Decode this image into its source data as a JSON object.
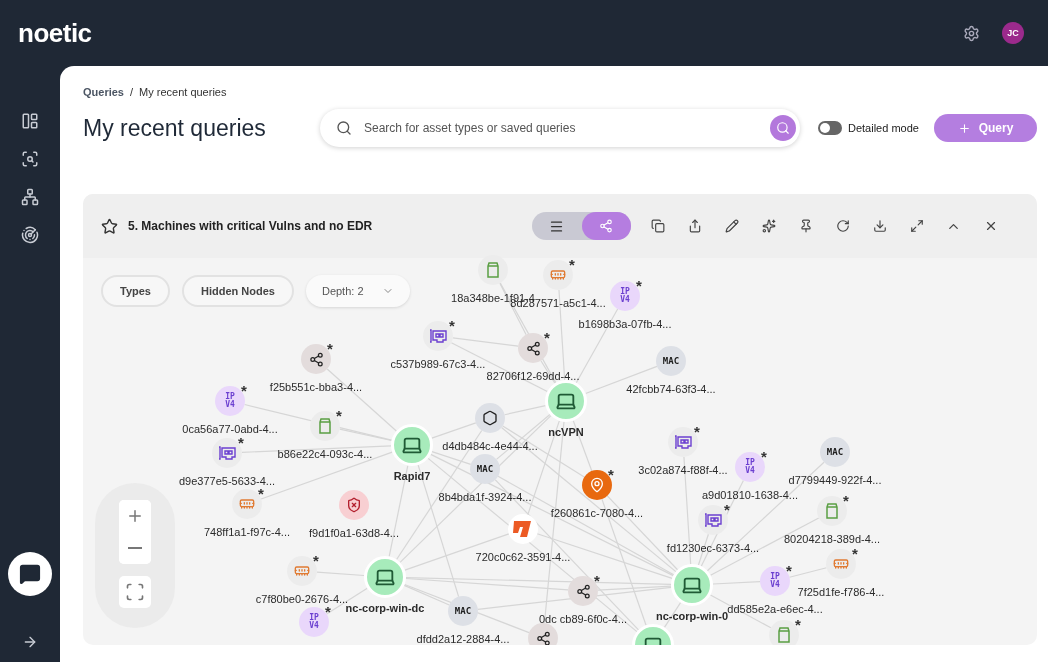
{
  "header": {
    "logo": "noetic",
    "avatar": "JC"
  },
  "breadcrumb": {
    "items": [
      "Queries",
      "My recent queries"
    ],
    "separator": "/"
  },
  "title": "My recent queries",
  "search": {
    "placeholder": "Search for asset types or saved queries"
  },
  "detailed_mode": {
    "label": "Detailed mode",
    "on": false
  },
  "query_button": {
    "label": "Query"
  },
  "card": {
    "title": "5. Machines with critical Vulns and no EDR",
    "starred": false,
    "views": [
      {
        "kind": "list",
        "selected": false
      },
      {
        "kind": "graph",
        "selected": true
      }
    ],
    "filters": [
      "Types",
      "Hidden Nodes"
    ],
    "depth": "Depth: 2",
    "nodes": [
      {
        "kind": "disk",
        "label": "18a348be-1f91-4"
      },
      {
        "kind": "memory",
        "label": "8d287571-a5c1-4...",
        "badge": "*"
      },
      {
        "kind": "ipv4",
        "icon_text": "IP V4",
        "label": "b1698b3a-07fb-4...",
        "badge": "*"
      },
      {
        "kind": "nic",
        "label": "c537b989-67c3-4...",
        "badge": "*"
      },
      {
        "kind": "hub",
        "label": "82706f12-69dd-4...",
        "badge": "*"
      },
      {
        "kind": "hub",
        "label": "f25b551c-bba3-4...",
        "badge": "*"
      },
      {
        "kind": "mac",
        "icon_text": "MAC",
        "label": "42fcbb74-63f3-4..."
      },
      {
        "kind": "ipv4",
        "icon_text": "IP V4",
        "label": "0ca56a77-0abd-4...",
        "badge": "*"
      },
      {
        "kind": "laptop",
        "label": "ncVPN"
      },
      {
        "kind": "hexagon",
        "label": "d4db484c-4e44-4..."
      },
      {
        "kind": "disk",
        "label": "b86e22c4-093c-4...",
        "badge": "*"
      },
      {
        "kind": "nic",
        "label": "d9e377e5-5633-4...",
        "badge": "*"
      },
      {
        "kind": "laptop",
        "label": "Rapid7"
      },
      {
        "kind": "nic",
        "label": "3c02a874-f88f-4...",
        "badge": "*"
      },
      {
        "kind": "mac",
        "icon_text": "MAC",
        "label": "d7799449-922f-4..."
      },
      {
        "kind": "mac",
        "icon_text": "MAC",
        "label": "8b4bda1f-3924-4..."
      },
      {
        "kind": "ipv4",
        "icon_text": "IP V4",
        "label": "a9d01810-1638-4...",
        "badge": "*"
      },
      {
        "kind": "location",
        "label": "f260861c-7080-4...",
        "badge": "*"
      },
      {
        "kind": "memory",
        "label": "748ff1a1-f97c-4...",
        "badge": "*"
      },
      {
        "kind": "shield",
        "label": "f9d1f0a1-63d8-4..."
      },
      {
        "kind": "logo",
        "label": "720c0c62-3591-4..."
      },
      {
        "kind": "nic",
        "label": "fd1230ec-6373-4...",
        "badge": "*"
      },
      {
        "kind": "disk",
        "label": "80204218-389d-4...",
        "badge": "*"
      },
      {
        "kind": "memory",
        "label": "c7f80be0-2676-4...",
        "badge": "*"
      },
      {
        "kind": "laptop",
        "label": "nc-corp-win-dc"
      },
      {
        "kind": "hub",
        "label": "0dc cb89-6f0c-4...",
        "badge": "*"
      },
      {
        "kind": "laptop",
        "label": "nc-corp-win-0"
      },
      {
        "kind": "ipv4",
        "icon_text": "IP V4",
        "label": "dd585e2a-e6ec-4...",
        "badge": "*"
      },
      {
        "kind": "memory",
        "label": "7f25d1fe-f786-4...",
        "badge": "*"
      },
      {
        "kind": "ipv4",
        "icon_text": "IP V4",
        "badge": "*"
      },
      {
        "kind": "mac",
        "icon_text": "MAC",
        "label": "dfdd2a12-2884-4..."
      },
      {
        "kind": "hub"
      },
      {
        "kind": "laptop"
      },
      {
        "kind": "disk",
        "badge": "*"
      }
    ]
  }
}
